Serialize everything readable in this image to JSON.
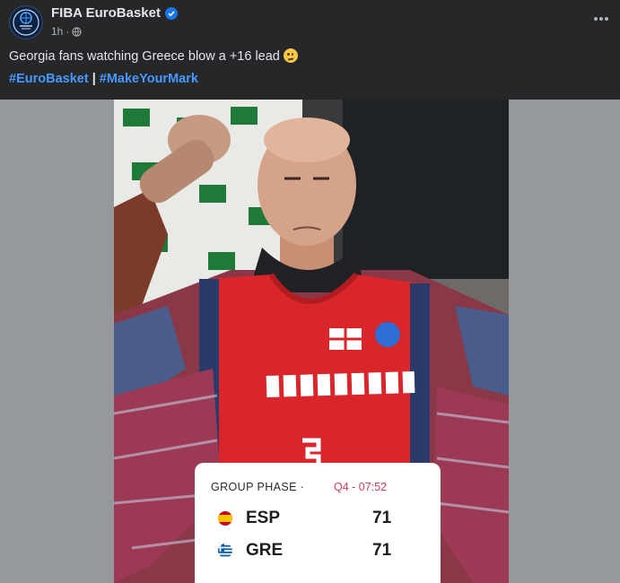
{
  "post": {
    "page_name": "FIBA EuroBasket",
    "time": "1h",
    "caption": "Georgia fans watching Greece blow a +16 lead",
    "hashtags": [
      "#EuroBasket",
      "#MakeYourMark"
    ],
    "hashtag_separator": "|"
  },
  "scoreboard": {
    "phase": "GROUP PHASE",
    "clock": "Q4 - 07:52",
    "teams": [
      {
        "code": "ESP",
        "score": "71",
        "flag": "spain-flag-icon"
      },
      {
        "code": "GRE",
        "score": "71",
        "flag": "greece-flag-icon"
      }
    ]
  },
  "colors": {
    "background": "#252728",
    "hashtag": "#4599ff",
    "verified": "#1b74e4",
    "clock": "#d23a5d",
    "jersey": "#d8262a"
  }
}
